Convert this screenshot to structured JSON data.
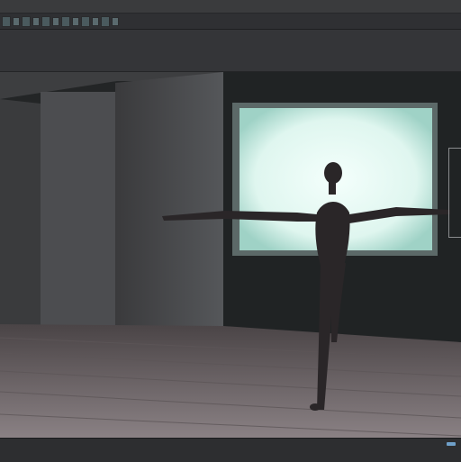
{
  "icons": {
    "toolbar": [
      "tool-icon",
      "tool-icon",
      "tool-icon",
      "tool-icon",
      "tool-icon",
      "tool-icon",
      "tool-icon",
      "tool-icon",
      "tool-icon",
      "tool-icon",
      "tool-icon",
      "tool-icon"
    ]
  },
  "colors": {
    "window_bg": "#343537",
    "glow": "#e8fbf6",
    "floor": "#6e6668",
    "accent": "#6fa0c9"
  }
}
